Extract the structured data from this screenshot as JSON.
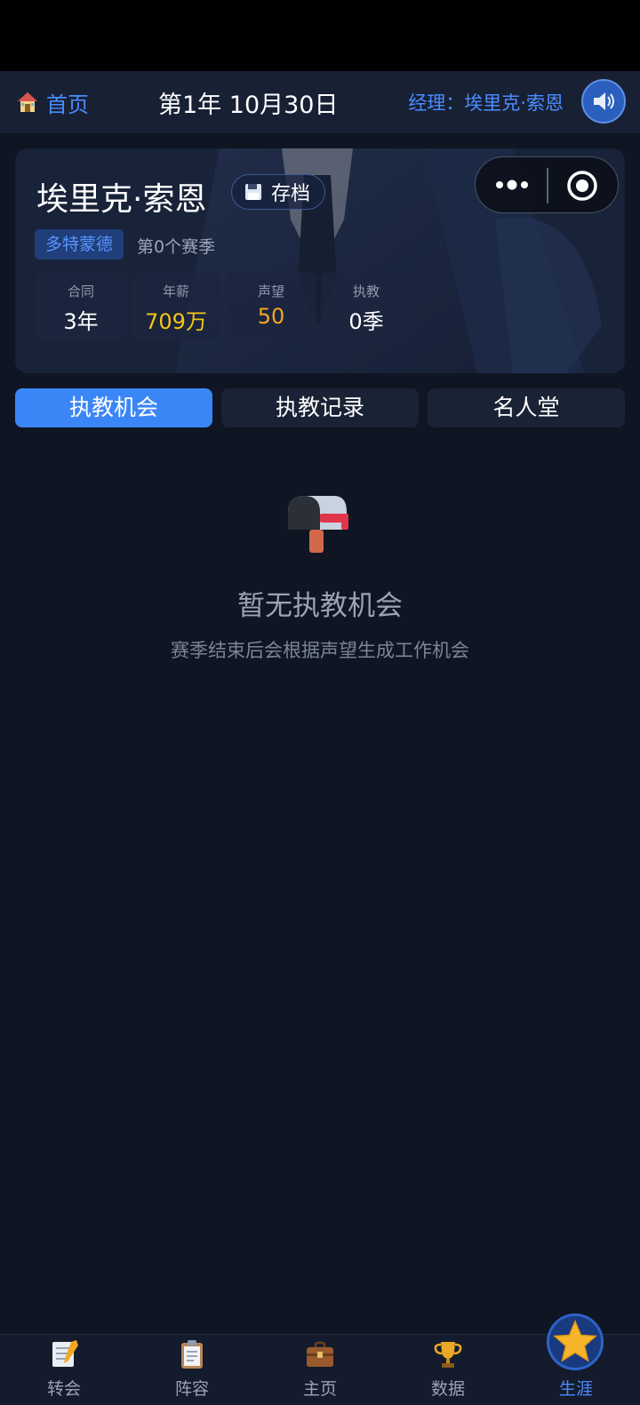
{
  "header": {
    "home_label": "首页",
    "date": "第1年 10月30日",
    "manager": "经理：埃里克·索恩"
  },
  "profile": {
    "name": "埃里克·索恩",
    "save_label": "存档",
    "team": "多特蒙德",
    "season_text": "第0个赛季",
    "stats": [
      {
        "label": "合同",
        "value": "3年",
        "color": "#ffffff"
      },
      {
        "label": "年薪",
        "value": "709万",
        "color": "#f5c518"
      },
      {
        "label": "声望",
        "value": "50",
        "color": "#f5a623"
      },
      {
        "label": "执教",
        "value": "0季",
        "color": "#ffffff"
      }
    ]
  },
  "tabs": [
    {
      "label": "执教机会",
      "active": true
    },
    {
      "label": "执教记录",
      "active": false
    },
    {
      "label": "名人堂",
      "active": false
    }
  ],
  "empty_state": {
    "icon": "mailbox-icon",
    "title": "暂无执教机会",
    "subtitle": "赛季结束后会根据声望生成工作机会"
  },
  "bottom_nav": [
    {
      "label": "转会",
      "icon": "memo-icon",
      "active": false
    },
    {
      "label": "阵容",
      "icon": "clipboard-icon",
      "active": false
    },
    {
      "label": "主页",
      "icon": "briefcase-icon",
      "active": false
    },
    {
      "label": "数据",
      "icon": "trophy-icon",
      "active": false
    },
    {
      "label": "生涯",
      "icon": "star-icon",
      "active": true
    }
  ],
  "colors": {
    "accent": "#3b86f7",
    "background": "#0f1522",
    "salary": "#f5c518",
    "reputation": "#f5a623"
  }
}
